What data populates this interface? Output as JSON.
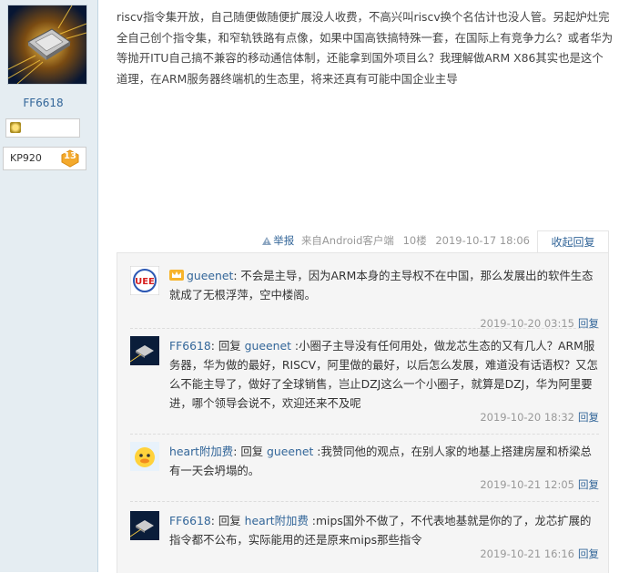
{
  "user": {
    "name": "FF6618",
    "group": "KP920",
    "level": "13"
  },
  "post": {
    "text": "riscv指令集开放，自己随便做随便扩展没人收费，不高兴叫riscv换个名估计也没人管。另起炉灶完全自己创个指令集，和窄轨铁路有点像，如果中国高铁搞特殊一套，在国际上有竞争力么？或者华为等抛开ITU自己搞不兼容的移动通信体制，还能拿到国外项目么？我理解做ARM X86其实也是这个道理，在ARM服务器终端机的生态里，将来还真有可能中国企业主导",
    "report": "举报",
    "source": "来自Android客户端",
    "floor": "10楼",
    "time": "2019-10-17 18:06",
    "collapse_reply": "收起回复"
  },
  "comments": [
    {
      "user": "gueenet",
      "prefix": "",
      "text": ": 不会是主导，因为ARM本身的主导权不在中国，那么发展出的软件生态就成了无根浮萍，空中楼阁。",
      "time": "2019-10-20 03:15",
      "action": "回复"
    },
    {
      "user": "FF6618",
      "prefix": ": 回复 ",
      "reply_to": "gueenet",
      "text": " :小圈子主导没有任何用处，做龙芯生态的又有几人？ARM服务器，华为做的最好，RISCV，阿里做的最好，以后怎么发展，难道没有话语权？又怎么不能主导了，做好了全球销售，岂止DZJ这么一个小圈子，就算是DZJ，华为阿里要进，哪个领导会说不，欢迎还来不及呢",
      "time": "2019-10-20 18:32",
      "action": "回复"
    },
    {
      "user": "heart附加费",
      "prefix": ": 回复 ",
      "reply_to": "gueenet",
      "text": " :我赞同他的观点，在别人家的地基上搭建房屋和桥梁总有一天会坍塌的。",
      "time": "2019-10-21 12:05",
      "action": "回复"
    },
    {
      "user": "FF6618",
      "prefix": ": 回复 ",
      "reply_to": "heart附加费",
      "text": " :mips国外不做了，不代表地基就是你的了，龙芯扩展的指令都不公布，实际能用的还是原来mips那些指令",
      "time": "2019-10-21 16:16",
      "action": "回复"
    }
  ],
  "colors": {
    "link": "#336699",
    "sidebar_bg": "#e5edf2",
    "meta": "#999999"
  }
}
